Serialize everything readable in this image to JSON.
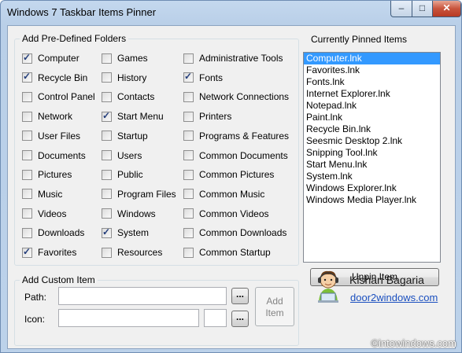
{
  "window": {
    "title": "Windows 7 Taskbar Items Pinner",
    "minimize_glyph": "–",
    "maximize_glyph": "□",
    "close_glyph": "✕"
  },
  "predefined": {
    "legend": "Add Pre-Defined Folders",
    "items": [
      {
        "label": "Computer",
        "checked": true
      },
      {
        "label": "Recycle Bin",
        "checked": true
      },
      {
        "label": "Control Panel",
        "checked": false
      },
      {
        "label": "Network",
        "checked": false
      },
      {
        "label": "User Files",
        "checked": false
      },
      {
        "label": "Documents",
        "checked": false
      },
      {
        "label": "Pictures",
        "checked": false
      },
      {
        "label": "Music",
        "checked": false
      },
      {
        "label": "Videos",
        "checked": false
      },
      {
        "label": "Downloads",
        "checked": false
      },
      {
        "label": "Favorites",
        "checked": true
      },
      {
        "label": "Games",
        "checked": false
      },
      {
        "label": "History",
        "checked": false
      },
      {
        "label": "Contacts",
        "checked": false
      },
      {
        "label": "Start Menu",
        "checked": true
      },
      {
        "label": "Startup",
        "checked": false
      },
      {
        "label": "Users",
        "checked": false
      },
      {
        "label": "Public",
        "checked": false
      },
      {
        "label": "Program Files",
        "checked": false
      },
      {
        "label": "Windows",
        "checked": false
      },
      {
        "label": "System",
        "checked": true
      },
      {
        "label": "Resources",
        "checked": false
      },
      {
        "label": "Administrative Tools",
        "checked": false
      },
      {
        "label": "Fonts",
        "checked": true
      },
      {
        "label": "Network Connections",
        "checked": false
      },
      {
        "label": "Printers",
        "checked": false
      },
      {
        "label": "Programs & Features",
        "checked": false
      },
      {
        "label": "Common Documents",
        "checked": false
      },
      {
        "label": "Common Pictures",
        "checked": false
      },
      {
        "label": "Common Music",
        "checked": false
      },
      {
        "label": "Common Videos",
        "checked": false
      },
      {
        "label": "Common Downloads",
        "checked": false
      },
      {
        "label": "Common Startup",
        "checked": false
      }
    ]
  },
  "pinned": {
    "legend": "Currently Pinned Items",
    "items": [
      "Computer.lnk",
      "Favorites.lnk",
      "Fonts.lnk",
      "Internet Explorer.lnk",
      "Notepad.lnk",
      "Paint.lnk",
      "Recycle Bin.lnk",
      "Seesmic Desktop 2.lnk",
      "Snipping Tool.lnk",
      "Start Menu.lnk",
      "System.lnk",
      "Windows Explorer.lnk",
      "Windows Media Player.lnk"
    ],
    "selected_item": "Computer.lnk",
    "unpin_label": "Unpin Item"
  },
  "custom": {
    "legend": "Add Custom Item",
    "path_label": "Path:",
    "path_value": "",
    "icon_label": "Icon:",
    "icon_value": "",
    "icon_index_value": "",
    "browse_label": "...",
    "add_label_line1": "Add",
    "add_label_line2": "Item"
  },
  "credits": {
    "author": "Kishan Bagaria",
    "site": "door2windows.com"
  },
  "watermark": "©intowindows.com",
  "colors": {
    "selection": "#3399ff",
    "link": "#1a4fbf",
    "check": "#233d7a"
  }
}
